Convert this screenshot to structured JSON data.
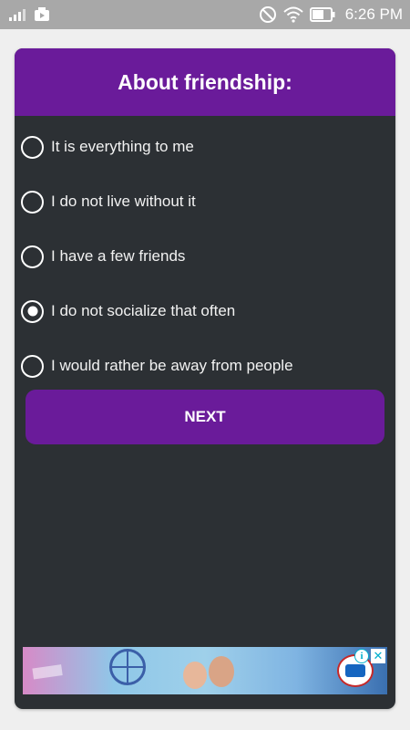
{
  "status_bar": {
    "time": "6:26 PM",
    "icons": [
      "signal-icon",
      "photo-notification-icon",
      "do-not-disturb-icon",
      "wifi-icon",
      "battery-icon"
    ]
  },
  "quiz": {
    "title": "About friendship:",
    "options": [
      {
        "label": "It is everything to me",
        "selected": false
      },
      {
        "label": "I do not live without it",
        "selected": false
      },
      {
        "label": "I have a few friends",
        "selected": false
      },
      {
        "label": "I do not socialize that often",
        "selected": true
      },
      {
        "label": "I would rather be away from people",
        "selected": false
      }
    ],
    "next_label": "NEXT"
  },
  "colors": {
    "accent": "#6a1b9a",
    "card_background": "#2c3034",
    "page_background": "#efefef",
    "status_bar": "#a8a8a8"
  },
  "ad": {
    "info_icon": "info-icon",
    "close_icon": "close-icon"
  }
}
